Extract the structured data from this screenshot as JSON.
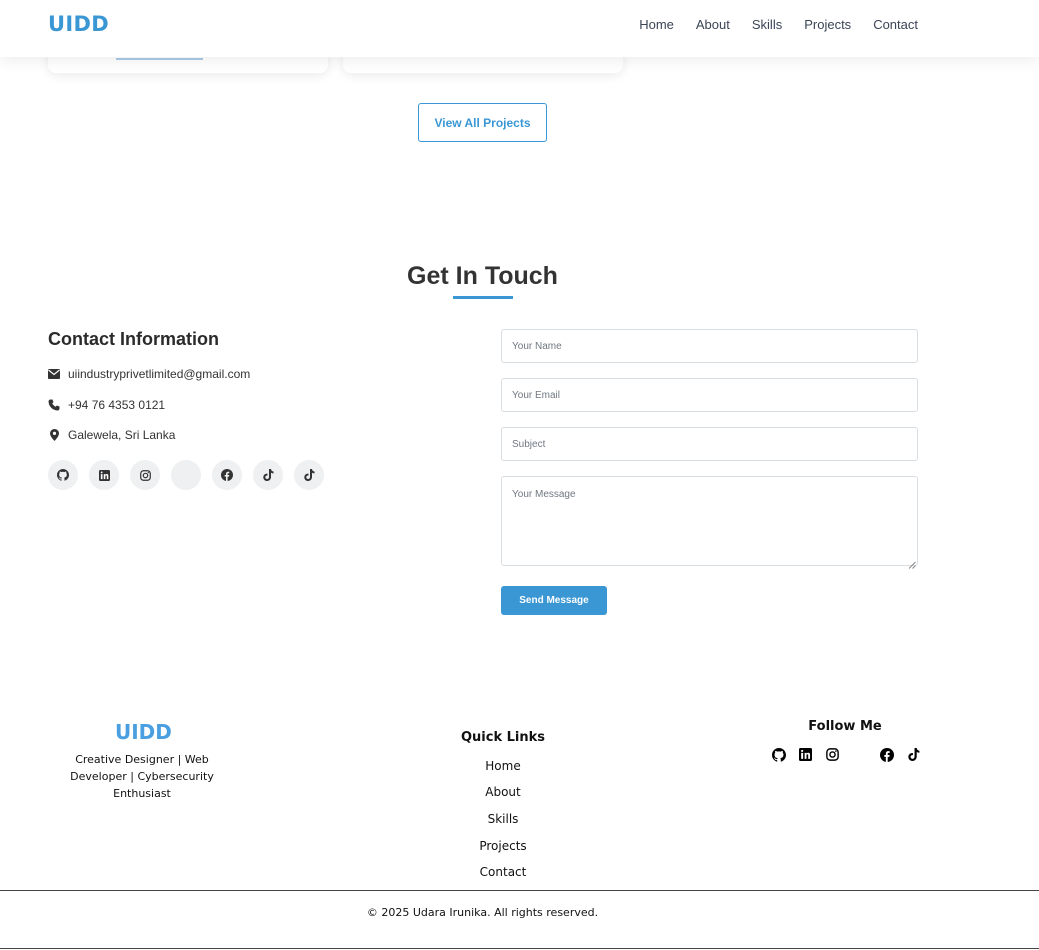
{
  "header": {
    "logo": "UIDD",
    "nav": [
      "Home",
      "About",
      "Skills",
      "Projects",
      "Contact"
    ]
  },
  "projects": {
    "view_all_label": "View All Projects"
  },
  "contact": {
    "title": "Get In Touch",
    "info_title": "Contact Information",
    "email": "uiindustryprivetlimited@gmail.com",
    "phone": "+94 76 4353 0121",
    "location": "Galewela, Sri Lanka",
    "socials": [
      "github-icon",
      "linkedin-icon",
      "instagram-icon",
      "blank-icon",
      "facebook-icon",
      "tiktok-icon",
      "tiktok-icon"
    ],
    "form": {
      "name_placeholder": "Your Name",
      "email_placeholder": "Your Email",
      "subject_placeholder": "Subject",
      "message_placeholder": "Your Message",
      "send_label": "Send Message"
    }
  },
  "footer": {
    "logo": "UIDD",
    "tagline": "Creative Designer | Web Developer | Cybersecurity Enthusiast",
    "quick_links_title": "Quick Links",
    "quick_links": [
      "Home",
      "About",
      "Skills",
      "Projects",
      "Contact"
    ],
    "follow_title": "Follow Me",
    "follow_icons": [
      "github-icon",
      "linkedin-icon",
      "instagram-icon",
      "blank-icon",
      "facebook-icon",
      "tiktok-icon"
    ],
    "copyright": "© 2025 Udara Irunika. All rights reserved."
  },
  "colors": {
    "accent": "#3a97d4",
    "text": "#333333",
    "icon_bg": "#eef0f1"
  }
}
